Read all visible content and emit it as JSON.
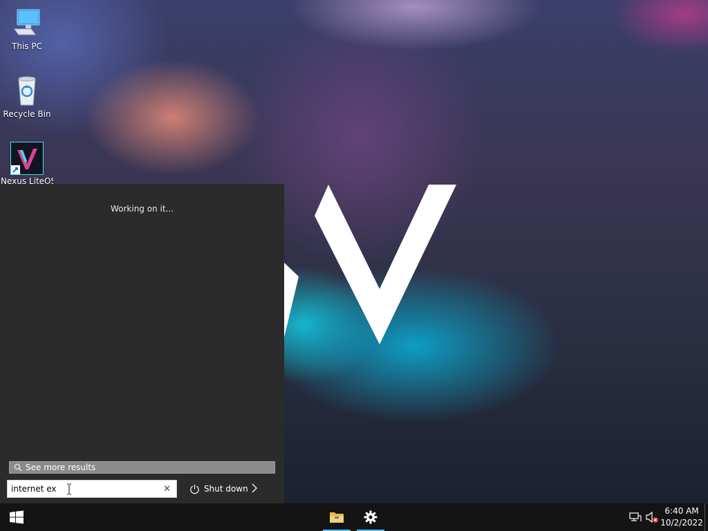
{
  "desktop": {
    "icons": [
      {
        "label": "This PC"
      },
      {
        "label": "Recycle Bin"
      },
      {
        "label": "Nexus LiteOS"
      }
    ]
  },
  "start_menu": {
    "status_text": "Working on it...",
    "see_more_label": "See more results",
    "search": {
      "value": "internet ex"
    },
    "shutdown_label": "Shut down"
  },
  "taskbar": {
    "apps": [
      {
        "icon": "file-explorer-icon"
      },
      {
        "icon": "settings-gear-icon"
      }
    ],
    "clock": {
      "time": "6:40 AM",
      "date": "10/2/2022"
    }
  },
  "colors": {
    "start_menu_bg": "#2b2b2b",
    "taskbar_bg": "#141414",
    "accent": "#4cc2ff"
  }
}
